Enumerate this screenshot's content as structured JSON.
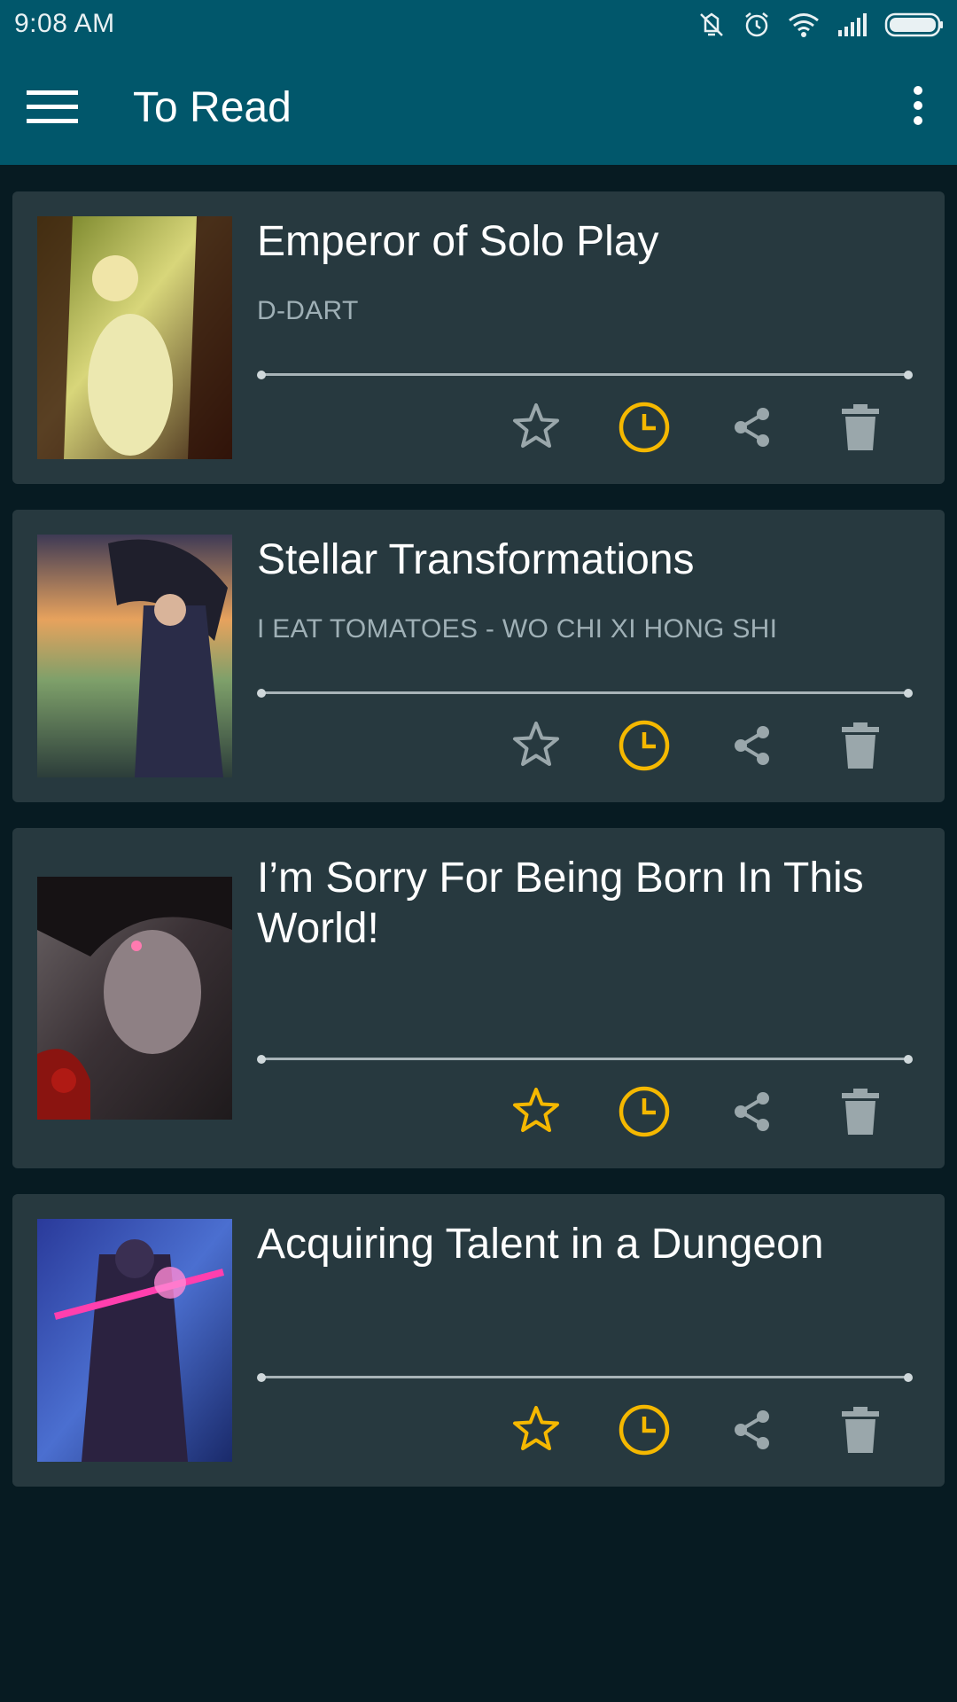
{
  "status_bar": {
    "time": "9:08 AM"
  },
  "app_bar": {
    "title": "To Read",
    "menu_icon": "hamburger-menu-icon",
    "overflow_icon": "more-vert-icon"
  },
  "colors": {
    "app_bar": "#01576b",
    "background": "#071b22",
    "card": "#27393f",
    "accent": "#f5b800",
    "icon_muted": "#9aa7ab"
  },
  "books": [
    {
      "title": "Emperor of Solo Play",
      "author": "D-DART",
      "progress": 0,
      "favorite": false,
      "reading_later": true
    },
    {
      "title": "Stellar Transformations",
      "author": "I EAT TOMATOES - WO CHI XI HONG SHI",
      "progress": 0,
      "favorite": false,
      "reading_later": true
    },
    {
      "title": "I’m Sorry For Being Born In This World!",
      "author": "",
      "progress": 0,
      "favorite": true,
      "reading_later": true
    },
    {
      "title": "Acquiring Talent in a Dungeon",
      "author": "",
      "progress": 0,
      "favorite": true,
      "reading_later": true
    }
  ],
  "action_icons": [
    "star-icon",
    "clock-icon",
    "share-icon",
    "delete-icon"
  ]
}
